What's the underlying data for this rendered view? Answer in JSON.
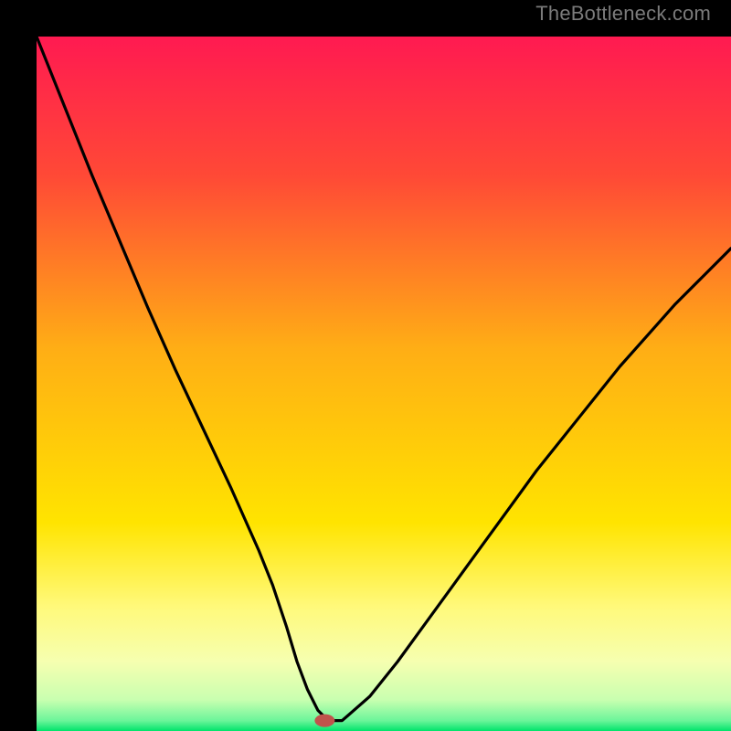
{
  "watermark": "TheBottleneck.com",
  "chart_data": {
    "type": "line",
    "title": "",
    "xlabel": "",
    "ylabel": "",
    "xlim": [
      0,
      100
    ],
    "ylim": [
      0,
      100
    ],
    "background_gradient_stops": [
      {
        "offset": 0.0,
        "color": "#ff1a51"
      },
      {
        "offset": 0.2,
        "color": "#ff4936"
      },
      {
        "offset": 0.45,
        "color": "#ffae15"
      },
      {
        "offset": 0.7,
        "color": "#ffe400"
      },
      {
        "offset": 0.82,
        "color": "#fff97a"
      },
      {
        "offset": 0.9,
        "color": "#f6ffb0"
      },
      {
        "offset": 0.955,
        "color": "#c9ffb0"
      },
      {
        "offset": 0.985,
        "color": "#6cf59a"
      },
      {
        "offset": 1.0,
        "color": "#00e46b"
      }
    ],
    "series": [
      {
        "name": "bottleneck-curve",
        "x": [
          0,
          4,
          8,
          12,
          16,
          20,
          24,
          28,
          32,
          34,
          36,
          37.5,
          39,
          40.5,
          42,
          44,
          48,
          52,
          56,
          60,
          64,
          68,
          72,
          76,
          80,
          84,
          88,
          92,
          96,
          100
        ],
        "y": [
          100,
          90,
          80,
          70.5,
          61,
          52,
          43.5,
          35,
          26,
          21,
          15,
          10,
          6,
          3,
          1.5,
          1.5,
          5,
          10,
          15.5,
          21,
          26.5,
          32,
          37.5,
          42.5,
          47.5,
          52.5,
          57,
          61.5,
          65.5,
          69.5
        ]
      }
    ],
    "optimum_marker": {
      "x": 41.5,
      "y": 1.5,
      "color": "#c0534c"
    },
    "floor_line": {
      "y_start": 1.5,
      "x_start": 37.5,
      "x_end": 44
    }
  }
}
